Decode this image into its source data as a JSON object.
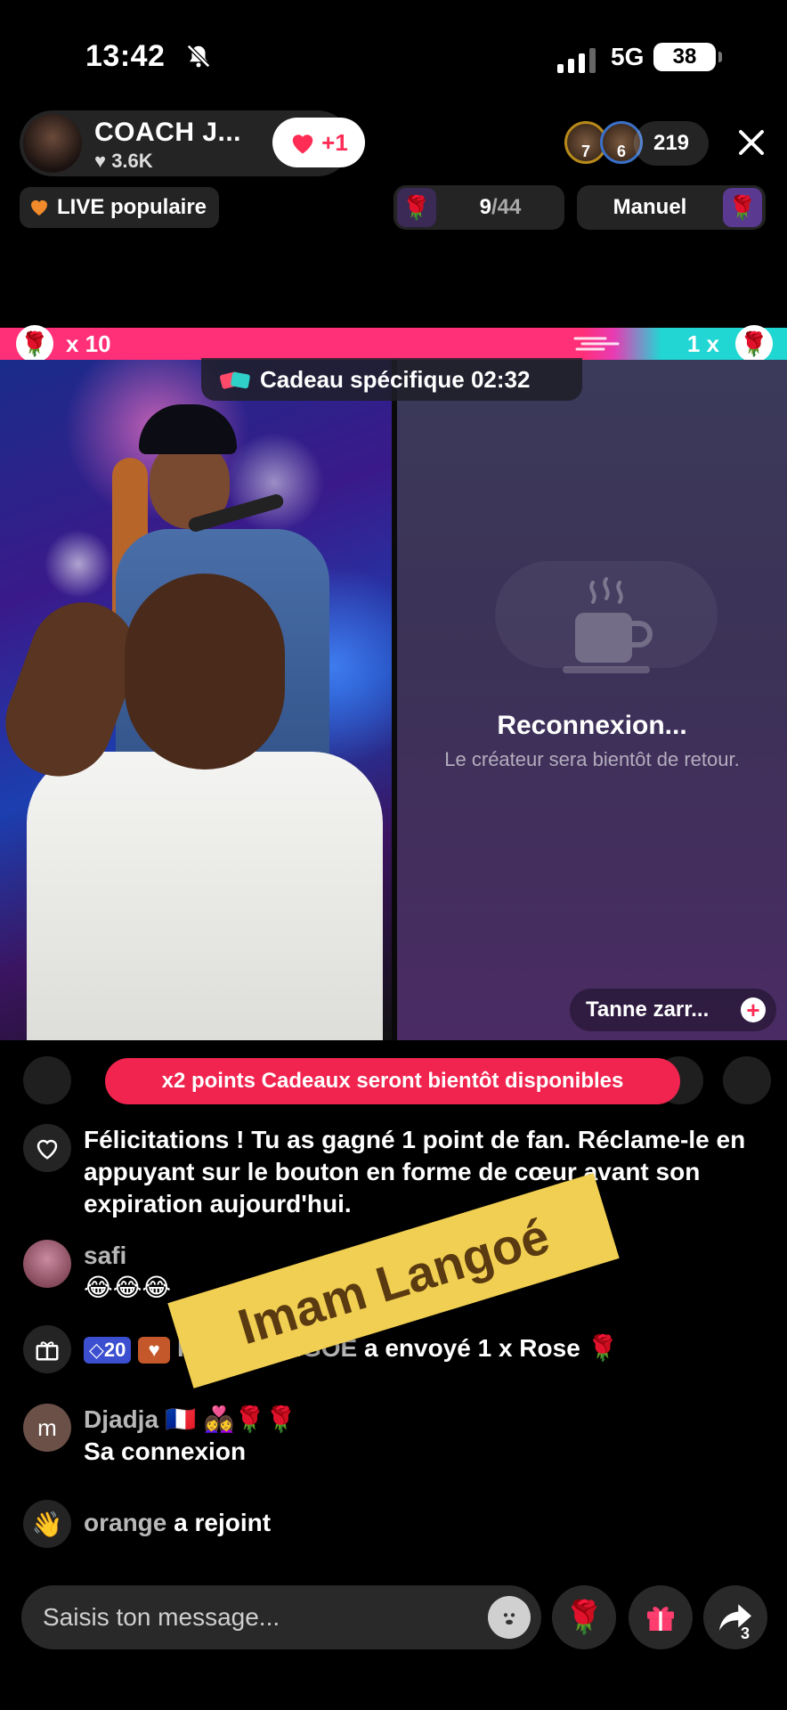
{
  "status_bar": {
    "time": "13:42",
    "network": "5G",
    "battery": "38"
  },
  "host": {
    "name": "COACH J...",
    "likes": "3.6K",
    "follow_label": "+1"
  },
  "viewers": {
    "badges": [
      "7",
      "6"
    ],
    "count": "219"
  },
  "live_tag": "LIVE populaire",
  "ranking": {
    "current": "9",
    "total": "/44"
  },
  "manual_label": "Manuel",
  "battle": {
    "left_score": "x 10",
    "right_score": "1 x",
    "left_color": "#ff2f78",
    "right_color": "#1fd7d2"
  },
  "gift_timer": {
    "label": "Cadeau spécifique 02:32"
  },
  "opponent": {
    "status_title": "Reconnexion...",
    "status_subtitle": "Le créateur sera bientôt de retour.",
    "name": "Tanne zarr..."
  },
  "banner": "x2 points Cadeaux seront bientôt disponibles",
  "messages": [
    {
      "text": "Félicitations ! Tu as gagné 1 point de fan. Réclame-le en appuyant sur le bouton en forme de cœur avant son expiration aujourd'hui."
    },
    {
      "user": "safi",
      "text": "😂😂😂"
    },
    {
      "badge_level": "20",
      "user": "IMAM LANGOÉ",
      "text": "a envoyé 1 x Rose 🌹"
    },
    {
      "avatar_letter": "m",
      "user": "Djadja 🇫🇷 👩‍❤️‍👩🌹🌹",
      "text": "Sa connexion"
    },
    {
      "user": "orange",
      "text": "a rejoint"
    }
  ],
  "watermark": "Imam Langoé",
  "input": {
    "placeholder": "Saisis ton message..."
  },
  "share_count": "3",
  "icons": [
    "bell-slash-icon",
    "signal-icon",
    "battery-icon",
    "heart-icon",
    "close-icon",
    "fire-heart-icon",
    "rose-icon",
    "gift-icon",
    "coffee-cup-icon",
    "plus-icon",
    "fan-heart-icon",
    "wave-hand-icon",
    "emoji-icon",
    "share-icon"
  ]
}
